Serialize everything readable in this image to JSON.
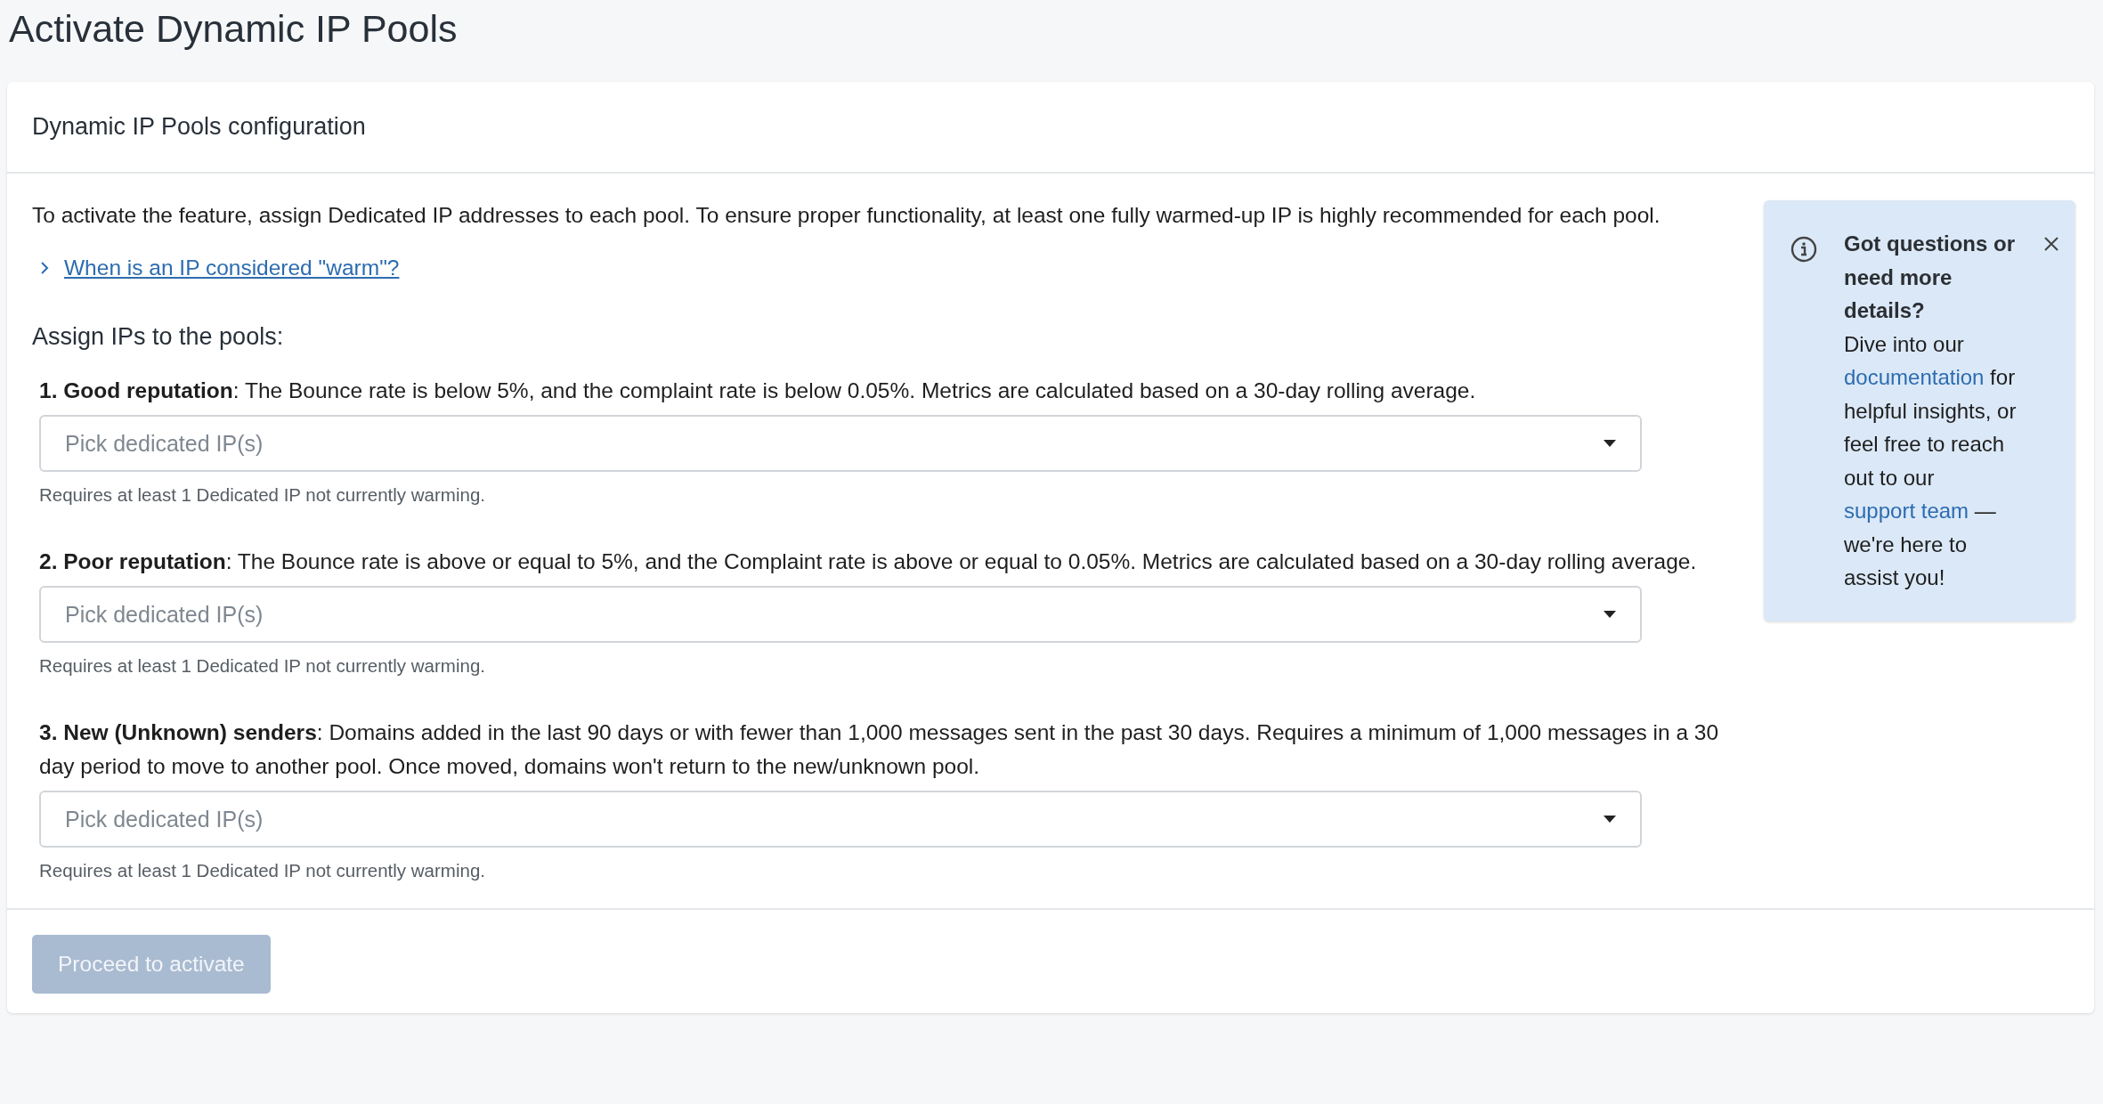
{
  "page": {
    "title": "Activate Dynamic IP Pools"
  },
  "card": {
    "title": "Dynamic IP Pools configuration",
    "intro": "To activate the feature, assign Dedicated IP addresses to each pool. To ensure proper functionality, at least one fully warmed-up IP is highly recommended for each pool.",
    "disclosure": {
      "label": "When is an IP considered \"warm\"?",
      "expanded": false
    },
    "section_title": "Assign IPs to the pools:",
    "pools": [
      {
        "description": "**1. Good reputation**: The Bounce rate is below 5%, and the complaint rate is below 0.05%. Metrics are calculated based on a 30-day rolling average.",
        "placeholder": "Pick dedicated IP(s)",
        "helper": "Requires at least 1 Dedicated IP not currently warming."
      },
      {
        "description": "**2. Poor reputation**: The Bounce rate is above or equal to 5%, and the Complaint rate is above or equal to 0.05%. Metrics are calculated based on a 30-day rolling average.",
        "placeholder": "Pick dedicated IP(s)",
        "helper": "Requires at least 1 Dedicated IP not currently warming."
      },
      {
        "description": "**3. New (Unknown) senders**: Domains added in the last 90 days or with fewer than 1,000 messages sent in the past 30 days. Requires a minimum of 1,000 messages in a 30 day period to move to another pool. Once moved, domains won't return to the new/unknown pool.",
        "placeholder": "Pick dedicated IP(s)",
        "helper": "Requires at least 1 Dedicated IP not currently warming."
      }
    ],
    "info": {
      "title": "Got questions or need more details?",
      "parts": [
        {
          "kind": "text",
          "text": "Dive into our "
        },
        {
          "kind": "link",
          "text": "documentation"
        },
        {
          "kind": "text",
          "text": " for helpful insights, or feel free to reach out to our "
        },
        {
          "kind": "link",
          "text": "support team"
        },
        {
          "kind": "text",
          "text": " — we're here to assist you!"
        }
      ]
    },
    "submit": {
      "label": "Proceed to activate",
      "disabled": true
    }
  }
}
